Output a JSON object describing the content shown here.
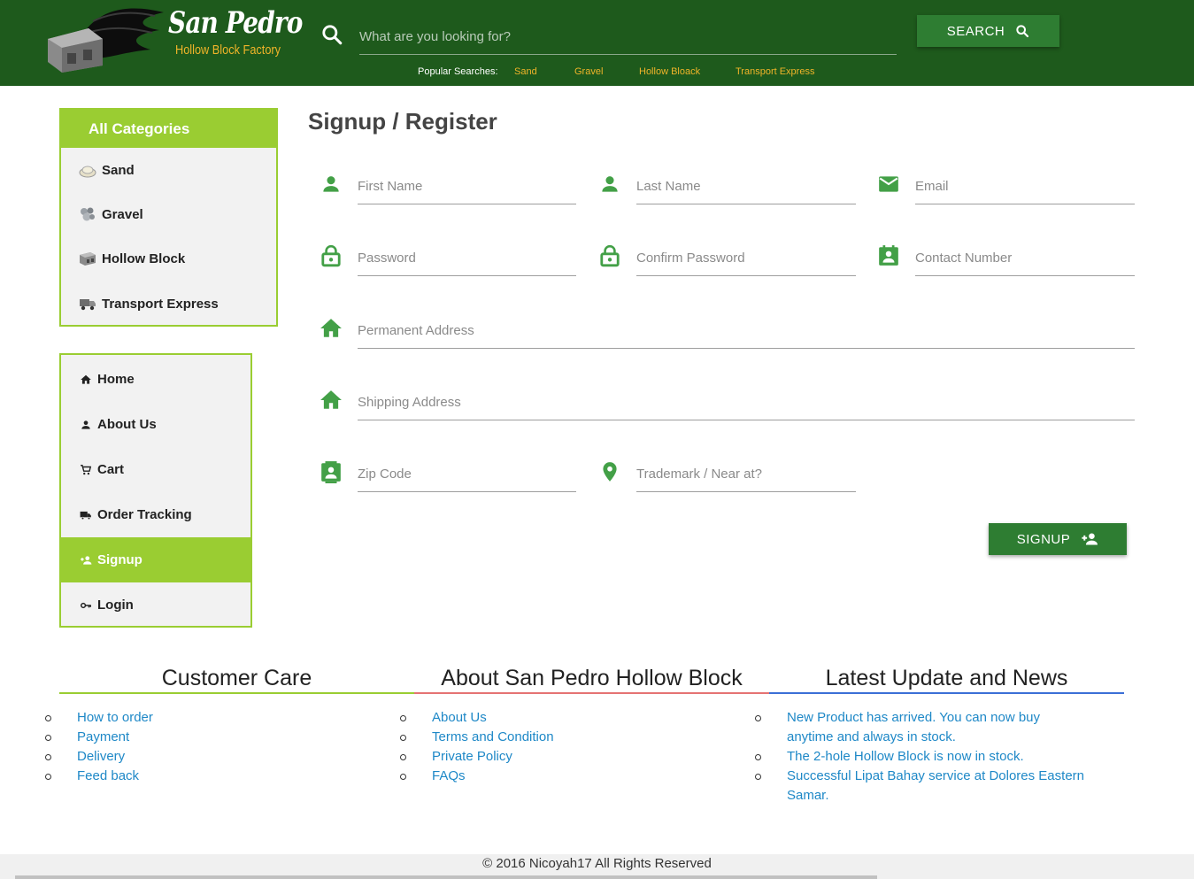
{
  "header": {
    "logo_title": "San Pedro",
    "logo_subtitle": "Hollow Block Factory",
    "search_placeholder": "What are you looking for?",
    "search_button": "SEARCH",
    "popular_label": "Popular Searches:",
    "popular_links": [
      "Sand",
      "Gravel",
      "Hollow Bloack",
      "Transport Express"
    ]
  },
  "categories": {
    "title": "All Categories",
    "items": [
      "Sand",
      "Gravel",
      "Hollow Block",
      "Transport Express"
    ]
  },
  "nav": {
    "items": [
      "Home",
      "About Us",
      "Cart",
      "Order Tracking",
      "Signup",
      "Login"
    ]
  },
  "form": {
    "title": "Signup / Register",
    "first_name": "First Name",
    "last_name": "Last Name",
    "email": "Email",
    "password": "Password",
    "confirm_password": "Confirm Password",
    "contact_number": "Contact Number",
    "permanent_address": "Permanent Address",
    "shipping_address": "Shipping Address",
    "zip_code": "Zip Code",
    "trademark": "Trademark / Near at?",
    "signup_button": "SIGNUP"
  },
  "footer": {
    "customer_care": {
      "title": "Customer Care",
      "links": [
        "How to order",
        "Payment",
        "Delivery",
        "Feed back"
      ]
    },
    "about": {
      "title": "About San Pedro Hollow Block",
      "links": [
        "About Us",
        "Terms and Condition",
        "Private Policy",
        "FAQs"
      ]
    },
    "news": {
      "title": "Latest Update and News",
      "links": [
        "New Product has arrived. You can now buy anytime and always in stock.",
        "The 2-hole Hollow Block is now in stock.",
        "Successful Lipat Bahay service at Dolores Eastern Samar."
      ]
    },
    "copyright": "© 2016 Nicoyah17 All Rights Reserved"
  },
  "colors": {
    "header_bg": "#1e5a1c",
    "accent_lime": "#9acd32",
    "button_green": "#2e7d32",
    "icon_green": "#43a047",
    "popular_yellow": "#f0b429",
    "link_blue": "#1e88c7",
    "divider_lime": "#9acd32",
    "divider_red": "#e57373",
    "divider_blue": "#3b6fd6"
  }
}
